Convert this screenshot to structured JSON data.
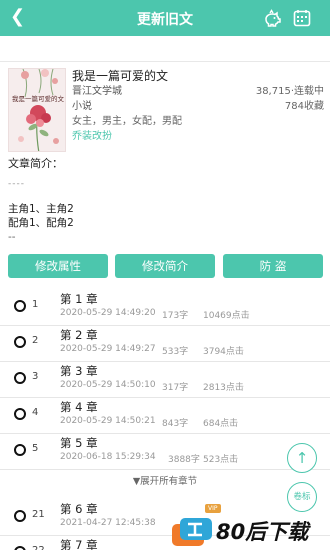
{
  "topbar": {
    "title": "更新旧文",
    "back_icon": "chevron-left-icon",
    "icons": [
      "piggy-bank-icon",
      "calendar-icon"
    ],
    "color": "#4cc6ad"
  },
  "book": {
    "cover_text": "我是一篇可爱的文",
    "title": "我是一篇可爱的文",
    "site": "晋江文学城",
    "stats": "38,715·连载中",
    "type": "小说",
    "favorites": "784收藏",
    "roles": "女主，男主，女配，男配",
    "dress_link": "乔装改扮"
  },
  "intro": {
    "heading": "文章简介：",
    "dashes": "----",
    "line1": "主角1、主角2",
    "line2": "配角1、配角2",
    "dashes2": "--"
  },
  "buttons": {
    "edit_props": "修改属性",
    "edit_intro": "修改简介",
    "anti_theft": "防 盗"
  },
  "chapters": [
    {
      "num": "1",
      "title": "第 1 章",
      "time": "2020-05-29 14:49:20",
      "words": "173字",
      "clicks": "10469点击",
      "vip": false
    },
    {
      "num": "2",
      "title": "第 2 章",
      "time": "2020-05-29 14:49:27",
      "words": "533字",
      "clicks": "3794点击",
      "vip": false
    },
    {
      "num": "3",
      "title": "第 3 章",
      "time": "2020-05-29 14:50:10",
      "words": "317字",
      "clicks": "2813点击",
      "vip": false
    },
    {
      "num": "4",
      "title": "第 4 章",
      "time": "2020-05-29 14:50:21",
      "words": "843字",
      "clicks": "684点击",
      "vip": false
    },
    {
      "num": "5",
      "title": "第 5 章",
      "time": "2020-06-18 15:29:34",
      "words": "3888字",
      "clicks": "523点击",
      "vip": false
    }
  ],
  "expand_label": "▼展开所有章节",
  "chapters_after": [
    {
      "num": "21",
      "title": "第 6 章",
      "time": "2021-04-27 12:45:38",
      "words": "",
      "clicks": "",
      "vip": true,
      "vip_label": "VIP"
    },
    {
      "num": "22",
      "title": "第 7 章",
      "time": "",
      "words": "",
      "clicks": "",
      "vip": false
    }
  ],
  "float": {
    "top_icon": "arrow-up-icon",
    "roll_label": "卷标"
  },
  "watermark": {
    "text": "80后下载"
  }
}
